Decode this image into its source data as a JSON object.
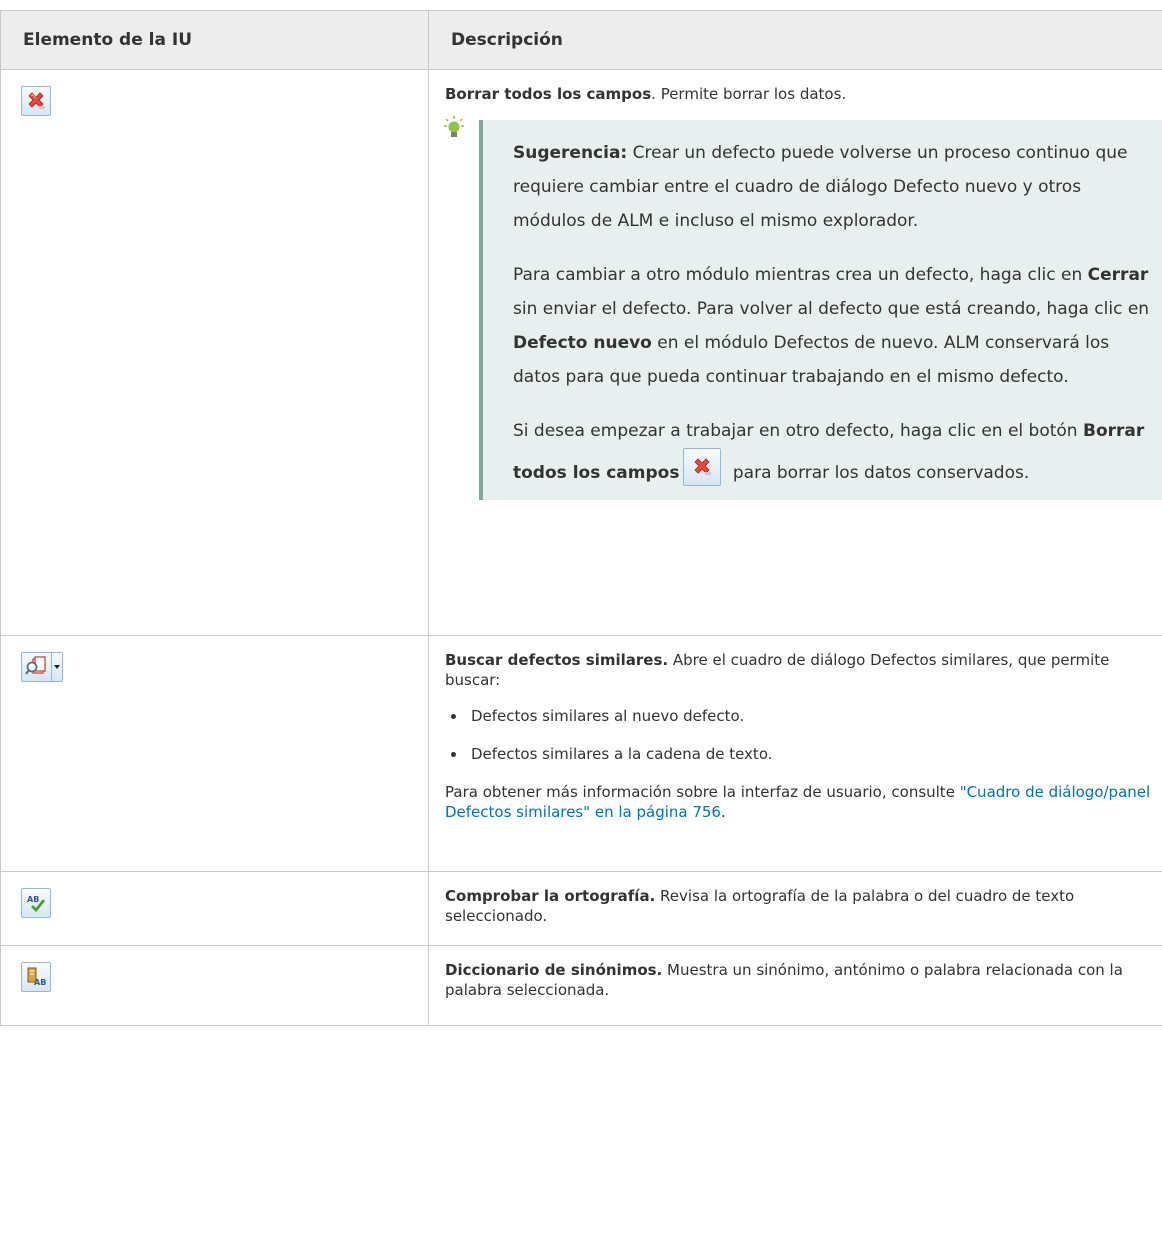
{
  "table": {
    "headers": {
      "col1": "Elemento de la IU",
      "col2": "Descripción"
    },
    "rows": [
      {
        "icon": "clear-all-fields-icon",
        "title": "Borrar todos los campos",
        "title_suffix": ". Permite borrar los datos.",
        "tip": {
          "icon": "lightbulb-icon",
          "label": "Sugerencia:",
          "p1": " Crear un defecto puede volverse un proceso continuo que requiere cambiar entre el cuadro de diálogo Defecto nuevo y otros módulos de ALM e incluso el mismo explorador.",
          "p2_a": "Para cambiar a otro módulo mientras crea un defecto, haga clic en ",
          "p2_b": "Cerrar",
          "p2_c": " sin enviar el defecto. Para volver al defecto que está creando, haga clic en ",
          "p2_d": "Defecto nuevo",
          "p2_e": " en el módulo Defectos de nuevo. ALM conservará los datos para que pueda continuar trabajando en el mismo defecto.",
          "p3_a": "Si desea empezar a trabajar en otro defecto, haga clic en el botón ",
          "p3_b": "Borrar todos los campos",
          "p3_c": " para borrar los datos conservados."
        }
      },
      {
        "icon": "find-similar-defects-icon",
        "title": "Buscar defectos similares.",
        "text": " Abre el cuadro de diálogo Defectos similares, que permite buscar:",
        "bullets": [
          "Defectos similares al nuevo defecto.",
          "Defectos similares a la cadena de texto."
        ],
        "more_prefix": "Para obtener más información sobre la interfaz de usuario, consulte ",
        "more_link": "\"Cuadro de diálogo/panel Defectos similares\" en la página 756",
        "more_suffix": "."
      },
      {
        "icon": "check-spelling-icon",
        "title": "Comprobar la ortografía.",
        "text": " Revisa la ortografía de la palabra o del cuadro de texto seleccionado."
      },
      {
        "icon": "thesaurus-icon",
        "title": "Diccionario de sinónimos.",
        "text": " Muestra un sinónimo, antónimo o palabra relacionada con la palabra seleccionada."
      }
    ]
  },
  "colors": {
    "header_bg": "#ededed",
    "tip_bg": "#e7f0ee",
    "tip_border": "#7fa89a",
    "link": "#0073b1"
  }
}
